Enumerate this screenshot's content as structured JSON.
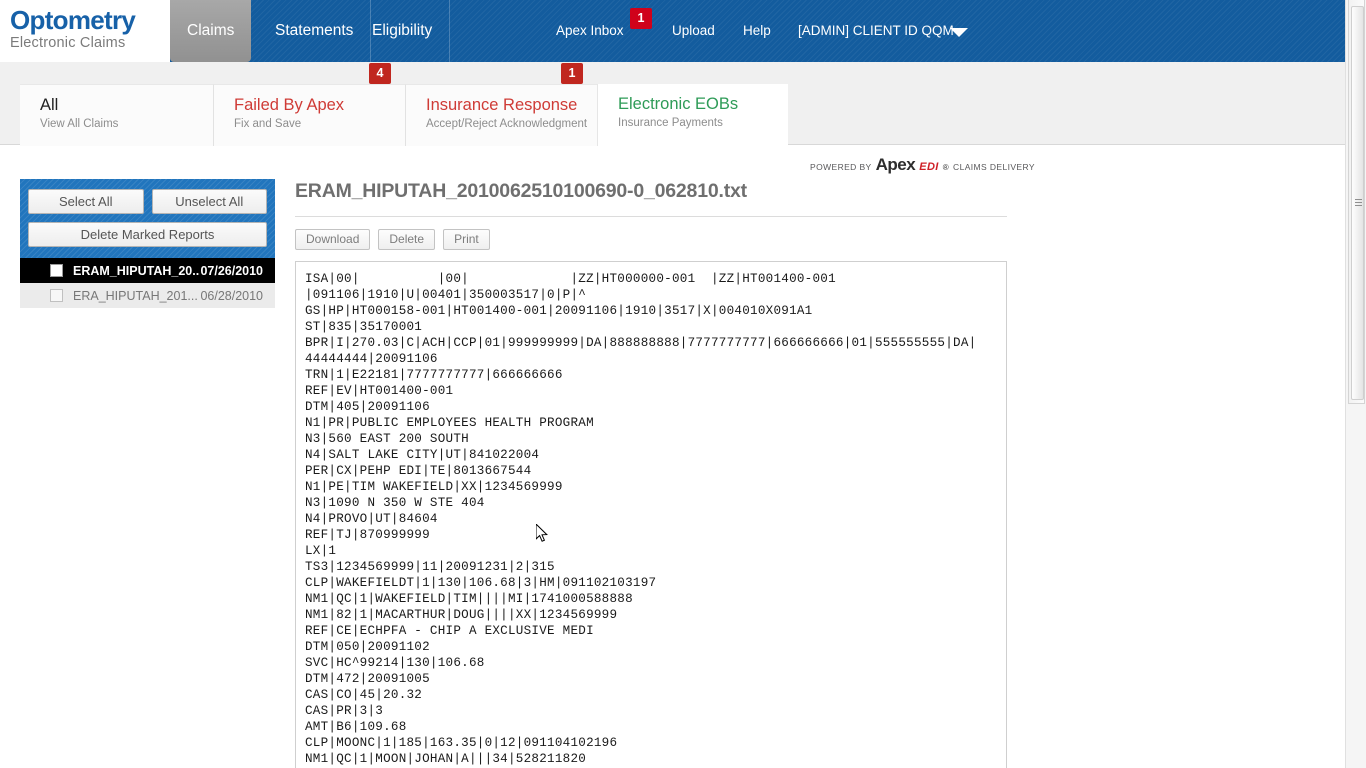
{
  "brand": {
    "logo_main": "Optometry",
    "logo_sub": "Electronic Claims",
    "accent_blue": "#135c9e",
    "accent_red": "#cf3b36",
    "accent_green": "#2e9b57"
  },
  "header": {
    "nav": [
      {
        "label": "Claims",
        "active": true
      },
      {
        "label": "Statements",
        "active": false
      },
      {
        "label": "Eligibility",
        "active": false
      }
    ],
    "right_links": [
      {
        "label": "Apex Inbox",
        "badge": "1"
      },
      {
        "label": "Upload",
        "badge": ""
      },
      {
        "label": "Help",
        "badge": ""
      },
      {
        "label": "[ADMIN] CLIENT ID QQM",
        "badge": ""
      }
    ],
    "caret_icon": "chevron-down-icon"
  },
  "subtabs": [
    {
      "title": "All",
      "subtitle": "View All Claims",
      "badge": "",
      "color": "t-black",
      "active": false
    },
    {
      "title": "Failed By Apex",
      "subtitle": "Fix and Save",
      "badge": "4",
      "color": "t-red",
      "active": false
    },
    {
      "title": "Insurance Response",
      "subtitle": "Accept/Reject Acknowledgment",
      "badge": "1",
      "color": "t-red",
      "active": false
    },
    {
      "title": "Electronic EOBs",
      "subtitle": "Insurance Payments",
      "badge": "",
      "color": "t-green",
      "active": true
    }
  ],
  "powered_by": {
    "prefix": "POWERED BY",
    "apex": "Apex",
    "edi": "EDI",
    "star": "®",
    "suffix": "CLAIMS DELIVERY"
  },
  "sidebar": {
    "select_all_label": "Select All",
    "unselect_all_label": "Unselect All",
    "delete_marked_label": "Delete Marked Reports",
    "reports": [
      {
        "name": "ERAM_HIPUTAH_20...",
        "date": "07/26/2010",
        "selected": true
      },
      {
        "name": "ERA_HIPUTAH_201...",
        "date": "06/28/2010",
        "selected": false
      }
    ]
  },
  "document": {
    "title": "ERAM_HIPUTAH_2010062510100690-0_062810.txt",
    "actions": [
      {
        "label": "Download"
      },
      {
        "label": "Delete"
      },
      {
        "label": "Print"
      }
    ],
    "content": "ISA|00|          |00|             |ZZ|HT000000-001  |ZZ|HT001400-001\n|091106|1910|U|00401|350003517|0|P|^\nGS|HP|HT000158-001|HT001400-001|20091106|1910|3517|X|004010X091A1\nST|835|35170001\nBPR|I|270.03|C|ACH|CCP|01|999999999|DA|888888888|7777777777|666666666|01|555555555|DA|\n44444444|20091106\nTRN|1|E22181|7777777777|666666666\nREF|EV|HT001400-001\nDTM|405|20091106\nN1|PR|PUBLIC EMPLOYEES HEALTH PROGRAM\nN3|560 EAST 200 SOUTH\nN4|SALT LAKE CITY|UT|841022004\nPER|CX|PEHP EDI|TE|8013667544\nN1|PE|TIM WAKEFIELD|XX|1234569999\nN3|1090 N 350 W STE 404\nN4|PROVO|UT|84604\nREF|TJ|870999999\nLX|1\nTS3|1234569999|11|20091231|2|315\nCLP|WAKEFIELDT|1|130|106.68|3|HM|091102103197\nNM1|QC|1|WAKEFIELD|TIM||||MI|1741000588888\nNM1|82|1|MACARTHUR|DOUG||||XX|1234569999\nREF|CE|ECHPFA - CHIP A EXCLUSIVE MEDI\nDTM|050|20091102\nSVC|HC^99214|130|106.68\nDTM|472|20091005\nCAS|CO|45|20.32\nCAS|PR|3|3\nAMT|B6|109.68\nCLP|MOONC|1|185|163.35|0|12|091104102196\nNM1|QC|1|MOON|JOHAN|A|||34|528211820"
  }
}
